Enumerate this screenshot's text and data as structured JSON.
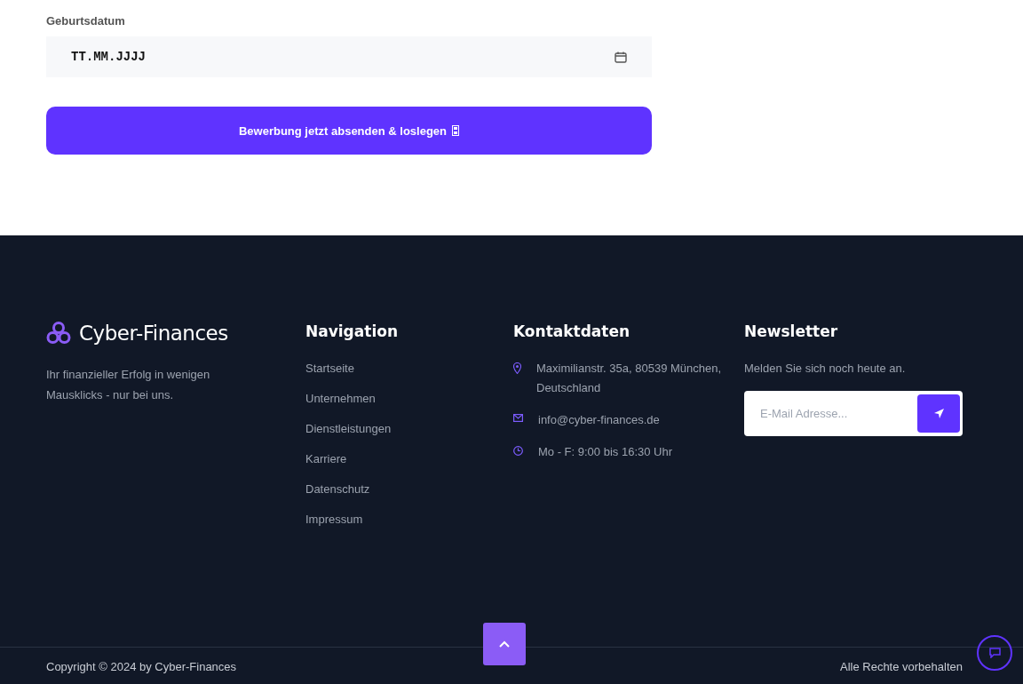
{
  "form": {
    "field_label": "Geburtsdatum",
    "date_field": {
      "value": "TT.MM.JJJJ"
    },
    "submit_button": "Bewerbung jetzt absenden & loslegen"
  },
  "footer": {
    "brand": {
      "name": "Cyber-Finances",
      "tagline": "Ihr finanzieller Erfolg in wenigen Mausklicks - nur bei uns."
    },
    "navigation": {
      "title": "Navigation",
      "links": [
        "Startseite",
        "Unternehmen",
        "Dienstleistungen",
        "Karriere",
        "Datenschutz",
        "Impressum"
      ]
    },
    "contact": {
      "title": "Kontaktdaten",
      "items": [
        {
          "kind": "address",
          "text": "Maximilianstr. 35a, 80539 München, Deutschland"
        },
        {
          "kind": "email",
          "text": "info@cyber-finances.de"
        },
        {
          "kind": "hours",
          "text": "Mo - F: 9:00 bis 16:30 Uhr"
        }
      ]
    },
    "newsletter": {
      "title": "Newsletter",
      "text": "Melden Sie sich noch heute an.",
      "email_field": {
        "placeholder": "E-Mail Adresse..."
      }
    },
    "copyright": "Copyright © 2024 by Cyber-Finances",
    "rights": "Alle Rechte vorbehalten"
  }
}
